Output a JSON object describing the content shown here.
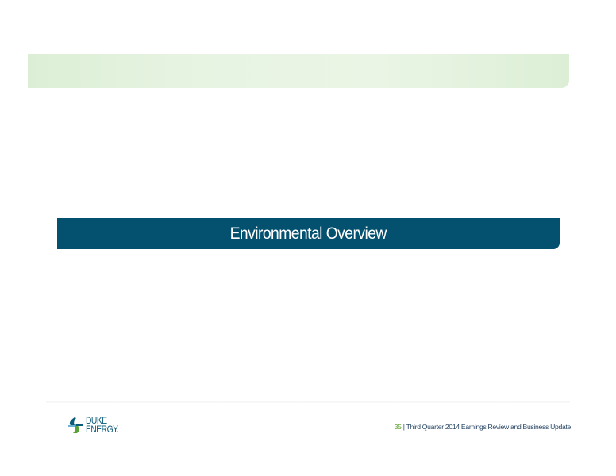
{
  "slide": {
    "section_title": "Environmental Overview"
  },
  "footer": {
    "logo": {
      "line1": "DUKE",
      "line2": "ENERGY."
    },
    "page_number": "35",
    "separator": " | ",
    "caption": "Third Quarter 2014 Earnings Review and Business Update"
  }
}
